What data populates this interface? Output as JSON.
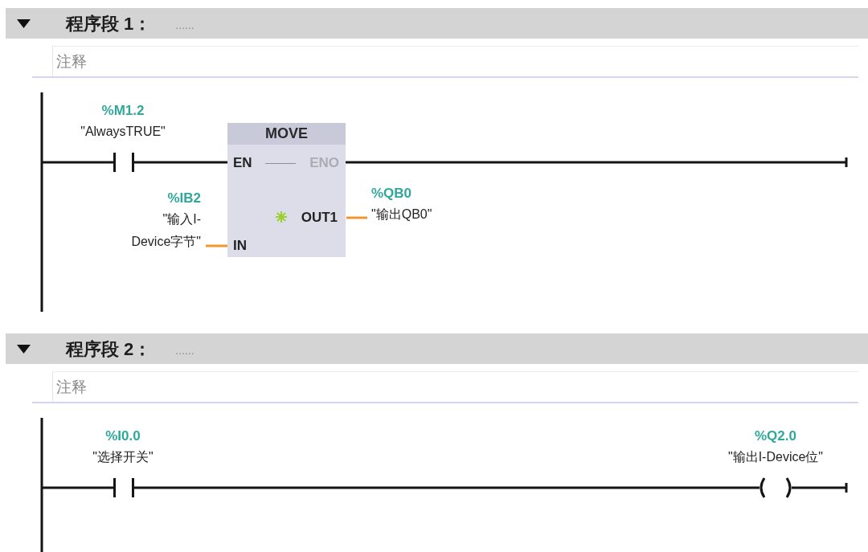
{
  "networks": [
    {
      "expanded": true,
      "label": "程序段 1：",
      "title_placeholder": "......",
      "comment_placeholder": "注释",
      "elements": [
        {
          "kind": "contact",
          "address": "%M1.2",
          "symbol": "\"AlwaysTRUE\""
        },
        {
          "kind": "box",
          "name": "MOVE",
          "inputs": [
            {
              "pin": "EN",
              "disabled": false
            },
            {
              "pin": "IN",
              "disabled": false,
              "address": "%IB2",
              "symbol": "\"输入I-Device字节\""
            }
          ],
          "outputs": [
            {
              "pin": "ENO",
              "disabled": true
            },
            {
              "pin": "OUT1",
              "disabled": false,
              "address": "%QB0",
              "symbol": "\"输出QB0\""
            }
          ]
        }
      ]
    },
    {
      "expanded": true,
      "label": "程序段 2：",
      "title_placeholder": "......",
      "comment_placeholder": "注释",
      "elements": [
        {
          "kind": "contact",
          "address": "%I0.0",
          "symbol": "\"选择开关\""
        },
        {
          "kind": "coil",
          "address": "%Q2.0",
          "symbol": "\"输出I-Device位\""
        }
      ]
    }
  ]
}
